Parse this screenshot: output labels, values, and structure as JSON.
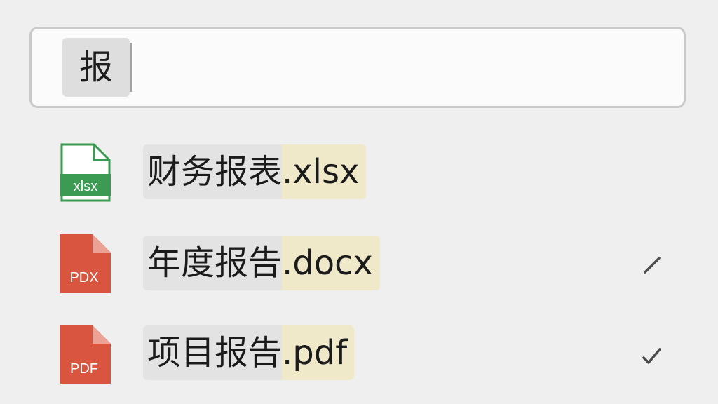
{
  "search": {
    "query": "报"
  },
  "results": [
    {
      "base": "财务报表",
      "ext": ".xlsx",
      "icon": "xlsx-file-icon",
      "icon_label": "xlsx",
      "icon_color": "#3b9b52",
      "checked": false
    },
    {
      "base": "年度报告",
      "ext": ".docx",
      "icon": "pdf-file-icon",
      "icon_label": "PDX",
      "icon_color": "#d9553f",
      "checked": true
    },
    {
      "base": "项目报告",
      "ext": ".pdf",
      "icon": "pdf-file-icon",
      "icon_label": "PDF",
      "icon_color": "#d9553f",
      "checked": true
    }
  ],
  "colors": {
    "background": "#efefef",
    "match_highlight": "#e3e3e3",
    "extension_highlight": "#efe8c9",
    "check": "#4a4a4a"
  }
}
